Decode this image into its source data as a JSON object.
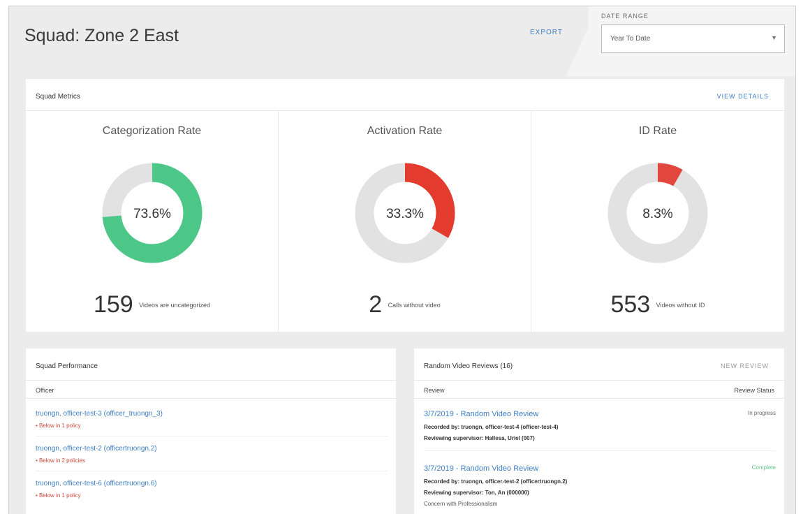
{
  "header": {
    "title": "Squad: Zone 2 East",
    "export_label": "EXPORT",
    "date_range_label": "DATE RANGE",
    "date_range_value": "Year To Date"
  },
  "metrics": {
    "title": "Squad Metrics",
    "view_details_label": "VIEW DETAILS",
    "items": [
      {
        "title": "Categorization Rate",
        "percent_label": "73.6%",
        "percent": 73.6,
        "color": "#4cc788",
        "count": "159",
        "description": "Videos are uncategorized"
      },
      {
        "title": "Activation Rate",
        "percent_label": "33.3%",
        "percent": 33.3,
        "color": "#e33b2e",
        "count": "2",
        "description": "Calls without video"
      },
      {
        "title": "ID Rate",
        "percent_label": "8.3%",
        "percent": 8.3,
        "color": "#e2473d",
        "count": "553",
        "description": "Videos without ID"
      }
    ]
  },
  "performance": {
    "title": "Squad Performance",
    "column_officer": "Officer",
    "rows": [
      {
        "name": "truongn, officer-test-3 (officer_truongn_3)",
        "policy": "•  Below in 1 policy"
      },
      {
        "name": "truongn, officer-test-2 (officertruongn.2)",
        "policy": "•  Below in 2 policies"
      },
      {
        "name": "truongn, officer-test-6 (officertruongn.6)",
        "policy": "•  Below in 1 policy"
      }
    ]
  },
  "reviews": {
    "title": "Random Video Reviews (16)",
    "new_review_label": "NEW REVIEW",
    "column_review": "Review",
    "column_status": "Review Status",
    "rows": [
      {
        "title": "3/7/2019 - Random Video Review",
        "status": "In progress",
        "recorded_by": "Recorded by: truongn, officer-test-4 (officer-test-4)",
        "supervisor": "Reviewing supervisor: Hallesa, Uriel (007)",
        "note": ""
      },
      {
        "title": "3/7/2019 - Random Video Review",
        "status": "Complete",
        "recorded_by": "Recorded by: truongn, officer-test-2 (officertruongn.2)",
        "supervisor": "Reviewing supervisor: Ton, An (000000)",
        "note": "Concern with Professionalism"
      }
    ]
  }
}
